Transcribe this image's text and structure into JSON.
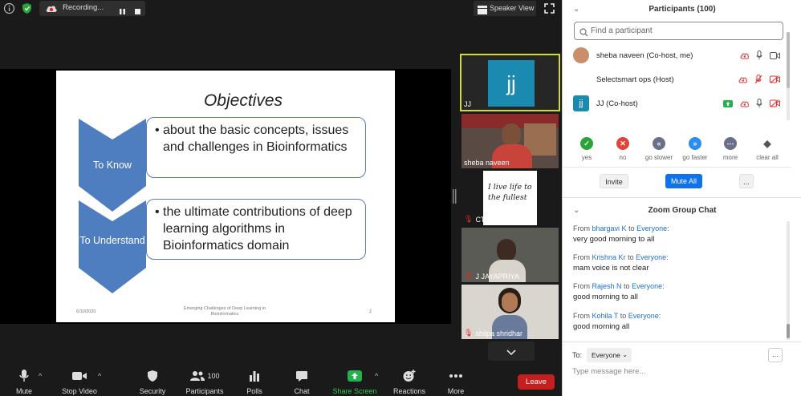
{
  "topbar": {
    "recording_label": "Recording...",
    "speaker_view_label": "Speaker View"
  },
  "slide": {
    "title": "Objectives",
    "items": [
      {
        "label": "To Know",
        "text": "about the basic concepts, issues and challenges  in Bioinformatics"
      },
      {
        "label": "To Understand",
        "text": "the ultimate contributions of deep learning algorithms in Bioinformatics domain"
      }
    ],
    "footer_date": "6/10/2020",
    "footer_title": "Emerging Challenges of Deep Learning in Bioinformatics",
    "footer_page": "2"
  },
  "gallery": [
    {
      "name": "JJ",
      "avatar_text": "jj",
      "muted": false,
      "active": true
    },
    {
      "name": "sheba naveen",
      "muted": false,
      "active": false
    },
    {
      "name": "CTOS",
      "image_text": "I live life to the fullest",
      "muted": true,
      "active": false
    },
    {
      "name": "J JAYAPRIYA",
      "muted": true,
      "active": false
    },
    {
      "name": "shilpa shridhar",
      "muted": true,
      "active": false
    }
  ],
  "toolbar": {
    "mute": "Mute",
    "stop_video": "Stop Video",
    "security": "Security",
    "participants": "Participants",
    "participants_count": "100",
    "polls": "Polls",
    "chat": "Chat",
    "share_screen": "Share Screen",
    "reactions": "Reactions",
    "more": "More",
    "leave": "Leave"
  },
  "participants_panel": {
    "title": "Participants (100)",
    "search_placeholder": "Find a participant",
    "list": [
      {
        "name": "sheba naveen (Co-host, me)"
      },
      {
        "name": "Selectsmart ops (Host)"
      },
      {
        "name": "JJ (Co-host)",
        "avatar_text": "jj"
      }
    ],
    "reactions": [
      "yes",
      "no",
      "go slower",
      "go faster",
      "more",
      "clear all"
    ],
    "invite": "Invite",
    "mute_all": "Mute All",
    "more_button": "..."
  },
  "chat_panel": {
    "title": "Zoom Group Chat",
    "messages": [
      {
        "from": "bhargavi K",
        "to": "Everyone",
        "text": "very good morning to all"
      },
      {
        "from": "Krishna Kr",
        "to": "Everyone",
        "text": "mam voice is not clear"
      },
      {
        "from": "Rajesh N",
        "to": "Everyone",
        "text": "good morning to all"
      },
      {
        "from": "Kohila T",
        "to": "Everyone",
        "text": "good morning all"
      }
    ],
    "from_word": "From",
    "to_word": "to",
    "to_label": "To:",
    "recipient": "Everyone",
    "input_placeholder": "Type message here...",
    "more_button": "..."
  },
  "colors": {
    "chevron": "#4f7ec0",
    "box_border": "#5b7dbc",
    "accent_blue": "#0e72ed",
    "leave_red": "#c41e1e",
    "active_tile_border": "#cddc39",
    "jj_avatar": "#1a8ab0"
  }
}
